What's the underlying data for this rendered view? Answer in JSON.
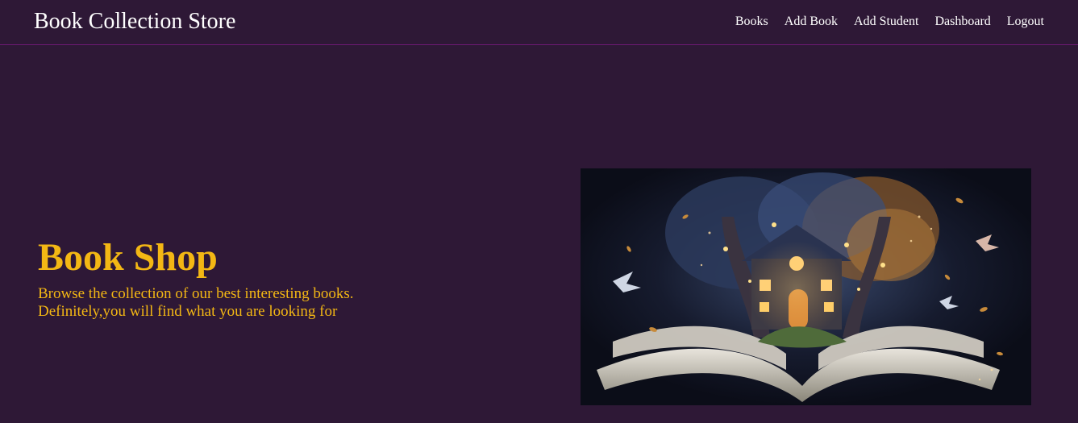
{
  "navbar": {
    "brand": "Book Collection Store",
    "links": [
      {
        "label": "Books"
      },
      {
        "label": "Add Book"
      },
      {
        "label": "Add Student"
      },
      {
        "label": "Dashboard"
      },
      {
        "label": "Logout"
      }
    ]
  },
  "hero": {
    "title": "Book Shop",
    "subtitle_line1": "Browse the collection of our best interesting books.",
    "subtitle_line2": "Definitely,you will find what you are looking for"
  },
  "colors": {
    "background": "#2e1836",
    "accent": "#f3b714",
    "nav_border": "#6d1a73",
    "text_light": "#ffffff"
  },
  "image": {
    "subject": "open-book-with-magical-treehouse-illustration"
  }
}
